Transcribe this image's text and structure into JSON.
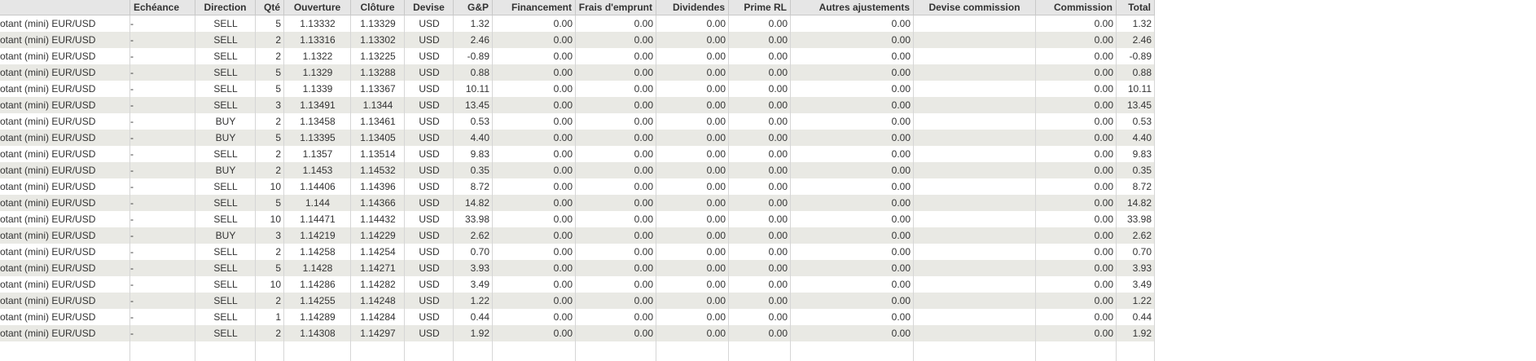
{
  "table": {
    "columns": [
      "",
      "Echéance",
      "Direction",
      "Qté",
      "Ouverture",
      "Clôture",
      "Devise",
      "G&P",
      "Financement",
      "Frais d'emprunt",
      "Dividendes",
      "Prime RL",
      "Autres ajustements",
      "Devise commission",
      "Commission",
      "Total"
    ],
    "rows": [
      [
        "otant (mini) EUR/USD",
        "-",
        "SELL",
        "5",
        "1.13332",
        "1.13329",
        "USD",
        "1.32",
        "0.00",
        "0.00",
        "0.00",
        "0.00",
        "0.00",
        "",
        "0.00",
        "1.32"
      ],
      [
        "otant (mini) EUR/USD",
        "-",
        "SELL",
        "2",
        "1.13316",
        "1.13302",
        "USD",
        "2.46",
        "0.00",
        "0.00",
        "0.00",
        "0.00",
        "0.00",
        "",
        "0.00",
        "2.46"
      ],
      [
        "otant (mini) EUR/USD",
        "-",
        "SELL",
        "2",
        "1.1322",
        "1.13225",
        "USD",
        "-0.89",
        "0.00",
        "0.00",
        "0.00",
        "0.00",
        "0.00",
        "",
        "0.00",
        "-0.89"
      ],
      [
        "otant (mini) EUR/USD",
        "-",
        "SELL",
        "5",
        "1.1329",
        "1.13288",
        "USD",
        "0.88",
        "0.00",
        "0.00",
        "0.00",
        "0.00",
        "0.00",
        "",
        "0.00",
        "0.88"
      ],
      [
        "otant (mini) EUR/USD",
        "-",
        "SELL",
        "5",
        "1.1339",
        "1.13367",
        "USD",
        "10.11",
        "0.00",
        "0.00",
        "0.00",
        "0.00",
        "0.00",
        "",
        "0.00",
        "10.11"
      ],
      [
        "otant (mini) EUR/USD",
        "-",
        "SELL",
        "3",
        "1.13491",
        "1.1344",
        "USD",
        "13.45",
        "0.00",
        "0.00",
        "0.00",
        "0.00",
        "0.00",
        "",
        "0.00",
        "13.45"
      ],
      [
        "otant (mini) EUR/USD",
        "-",
        "BUY",
        "2",
        "1.13458",
        "1.13461",
        "USD",
        "0.53",
        "0.00",
        "0.00",
        "0.00",
        "0.00",
        "0.00",
        "",
        "0.00",
        "0.53"
      ],
      [
        "otant (mini) EUR/USD",
        "-",
        "BUY",
        "5",
        "1.13395",
        "1.13405",
        "USD",
        "4.40",
        "0.00",
        "0.00",
        "0.00",
        "0.00",
        "0.00",
        "",
        "0.00",
        "4.40"
      ],
      [
        "otant (mini) EUR/USD",
        "-",
        "SELL",
        "2",
        "1.1357",
        "1.13514",
        "USD",
        "9.83",
        "0.00",
        "0.00",
        "0.00",
        "0.00",
        "0.00",
        "",
        "0.00",
        "9.83"
      ],
      [
        "otant (mini) EUR/USD",
        "-",
        "BUY",
        "2",
        "1.1453",
        "1.14532",
        "USD",
        "0.35",
        "0.00",
        "0.00",
        "0.00",
        "0.00",
        "0.00",
        "",
        "0.00",
        "0.35"
      ],
      [
        "otant (mini) EUR/USD",
        "-",
        "SELL",
        "10",
        "1.14406",
        "1.14396",
        "USD",
        "8.72",
        "0.00",
        "0.00",
        "0.00",
        "0.00",
        "0.00",
        "",
        "0.00",
        "8.72"
      ],
      [
        "otant (mini) EUR/USD",
        "-",
        "SELL",
        "5",
        "1.144",
        "1.14366",
        "USD",
        "14.82",
        "0.00",
        "0.00",
        "0.00",
        "0.00",
        "0.00",
        "",
        "0.00",
        "14.82"
      ],
      [
        "otant (mini) EUR/USD",
        "-",
        "SELL",
        "10",
        "1.14471",
        "1.14432",
        "USD",
        "33.98",
        "0.00",
        "0.00",
        "0.00",
        "0.00",
        "0.00",
        "",
        "0.00",
        "33.98"
      ],
      [
        "otant (mini) EUR/USD",
        "-",
        "BUY",
        "3",
        "1.14219",
        "1.14229",
        "USD",
        "2.62",
        "0.00",
        "0.00",
        "0.00",
        "0.00",
        "0.00",
        "",
        "0.00",
        "2.62"
      ],
      [
        "otant (mini) EUR/USD",
        "-",
        "SELL",
        "2",
        "1.14258",
        "1.14254",
        "USD",
        "0.70",
        "0.00",
        "0.00",
        "0.00",
        "0.00",
        "0.00",
        "",
        "0.00",
        "0.70"
      ],
      [
        "otant (mini) EUR/USD",
        "-",
        "SELL",
        "5",
        "1.1428",
        "1.14271",
        "USD",
        "3.93",
        "0.00",
        "0.00",
        "0.00",
        "0.00",
        "0.00",
        "",
        "0.00",
        "3.93"
      ],
      [
        "otant (mini) EUR/USD",
        "-",
        "SELL",
        "10",
        "1.14286",
        "1.14282",
        "USD",
        "3.49",
        "0.00",
        "0.00",
        "0.00",
        "0.00",
        "0.00",
        "",
        "0.00",
        "3.49"
      ],
      [
        "otant (mini) EUR/USD",
        "-",
        "SELL",
        "2",
        "1.14255",
        "1.14248",
        "USD",
        "1.22",
        "0.00",
        "0.00",
        "0.00",
        "0.00",
        "0.00",
        "",
        "0.00",
        "1.22"
      ],
      [
        "otant (mini) EUR/USD",
        "-",
        "SELL",
        "1",
        "1.14289",
        "1.14284",
        "USD",
        "0.44",
        "0.00",
        "0.00",
        "0.00",
        "0.00",
        "0.00",
        "",
        "0.00",
        "0.44"
      ],
      [
        "otant (mini) EUR/USD",
        "-",
        "SELL",
        "2",
        "1.14308",
        "1.14297",
        "USD",
        "1.92",
        "0.00",
        "0.00",
        "0.00",
        "0.00",
        "0.00",
        "",
        "0.00",
        "1.92"
      ]
    ]
  }
}
